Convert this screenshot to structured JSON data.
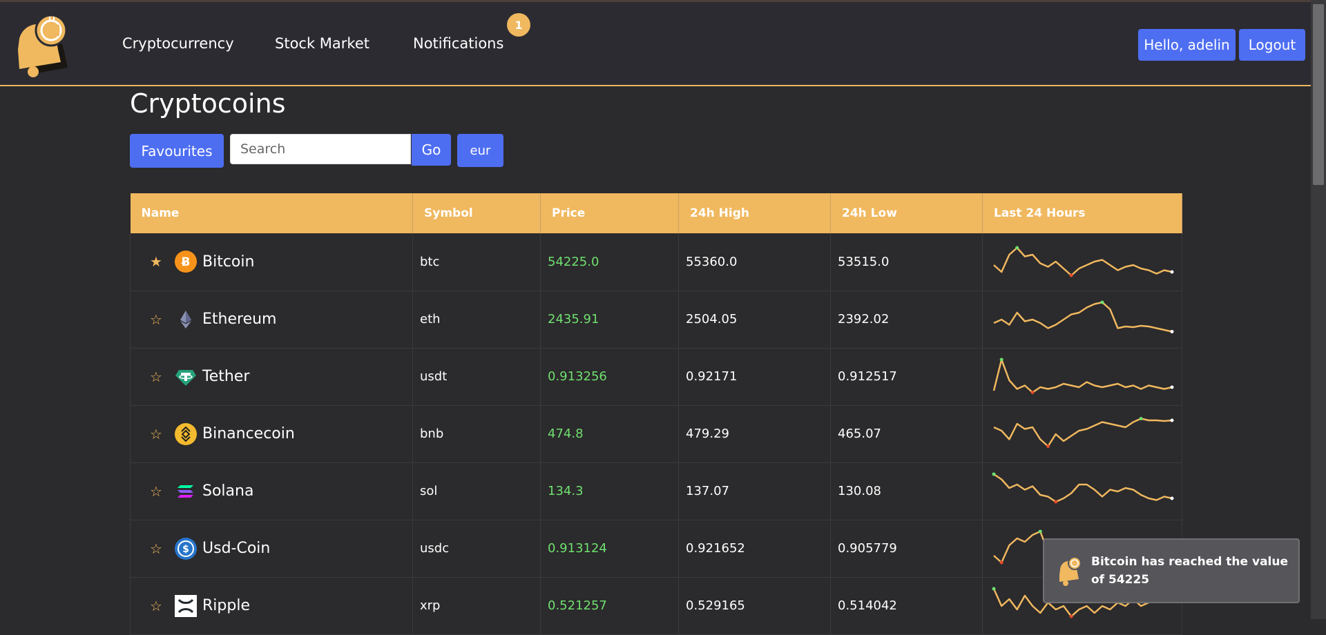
{
  "nav": {
    "links": [
      "Cryptocurrency",
      "Stock Market",
      "Notifications"
    ],
    "notification_count": "1",
    "greeting": "Hello, adelin",
    "logout": "Logout"
  },
  "page": {
    "title": "Cryptocoins",
    "favourites_label": "Favourites",
    "search_placeholder": "Search",
    "go_label": "Go",
    "currency": "eur"
  },
  "table": {
    "headers": [
      "Name",
      "Symbol",
      "Price",
      "24h High",
      "24h Low",
      "Last 24 Hours"
    ],
    "rows": [
      {
        "favourite": true,
        "icon": "bitcoin-icon",
        "name": "Bitcoin",
        "symbol": "btc",
        "price": "54225.0",
        "high": "55360.0",
        "low": "53515.0",
        "spark": [
          0.6,
          0.8,
          0.3,
          0.1,
          0.35,
          0.3,
          0.55,
          0.65,
          0.5,
          0.7,
          0.9,
          0.7,
          0.6,
          0.5,
          0.45,
          0.6,
          0.75,
          0.65,
          0.6,
          0.7,
          0.75,
          0.85,
          0.75,
          0.8
        ]
      },
      {
        "favourite": false,
        "icon": "ethereum-icon",
        "name": "Ethereum",
        "symbol": "eth",
        "price": "2435.91",
        "high": "2504.05",
        "low": "2392.02",
        "spark": [
          0.6,
          0.5,
          0.65,
          0.3,
          0.55,
          0.5,
          0.6,
          0.75,
          0.65,
          0.5,
          0.35,
          0.3,
          0.15,
          0.05,
          0.0,
          0.2,
          0.75,
          0.7,
          0.72,
          0.68,
          0.7,
          0.75,
          0.8,
          0.85
        ]
      },
      {
        "favourite": false,
        "icon": "tether-icon",
        "name": "Tether",
        "symbol": "usdt",
        "price": "0.913256",
        "high": "0.92171",
        "low": "0.912517",
        "spark": [
          0.9,
          0.0,
          0.6,
          0.85,
          0.75,
          0.95,
          0.8,
          0.85,
          0.8,
          0.7,
          0.75,
          0.8,
          0.65,
          0.75,
          0.8,
          0.75,
          0.7,
          0.8,
          0.75,
          0.85,
          0.75,
          0.8,
          0.85,
          0.8
        ]
      },
      {
        "favourite": false,
        "icon": "binance-icon",
        "name": "Binancecoin",
        "symbol": "bnb",
        "price": "474.8",
        "high": "479.29",
        "low": "465.07",
        "spark": [
          0.3,
          0.4,
          0.65,
          0.2,
          0.35,
          0.3,
          0.65,
          0.85,
          0.5,
          0.7,
          0.55,
          0.4,
          0.35,
          0.25,
          0.15,
          0.2,
          0.25,
          0.3,
          0.15,
          0.05,
          0.1,
          0.1,
          0.12,
          0.1
        ]
      },
      {
        "favourite": false,
        "icon": "solana-icon",
        "name": "Solana",
        "symbol": "sol",
        "price": "134.3",
        "high": "137.07",
        "low": "130.08",
        "spark": [
          0.0,
          0.15,
          0.4,
          0.3,
          0.45,
          0.35,
          0.6,
          0.65,
          0.8,
          0.7,
          0.55,
          0.3,
          0.3,
          0.45,
          0.65,
          0.45,
          0.5,
          0.4,
          0.45,
          0.6,
          0.7,
          0.75,
          0.65,
          0.7
        ]
      },
      {
        "favourite": false,
        "icon": "usdc-icon",
        "name": "Usd-Coin",
        "symbol": "usdc",
        "price": "0.913124",
        "high": "0.921652",
        "low": "0.905779",
        "spark": [
          0.7,
          0.9,
          0.4,
          0.2,
          0.3,
          0.1,
          0.0,
          0.6,
          0.5,
          0.45,
          0.7,
          0.6,
          0.5,
          0.55,
          0.6,
          0.5,
          0.55,
          0.5,
          0.6,
          0.55,
          0.5,
          0.6,
          0.55,
          0.6
        ]
      },
      {
        "favourite": false,
        "icon": "ripple-icon",
        "name": "Ripple",
        "symbol": "xrp",
        "price": "0.521257",
        "high": "0.529165",
        "low": "0.514042",
        "spark": [
          0.0,
          0.5,
          0.3,
          0.6,
          0.2,
          0.5,
          0.7,
          0.4,
          0.6,
          0.5,
          0.8,
          0.6,
          0.5,
          0.7,
          0.5,
          0.6,
          0.4,
          0.5,
          0.3,
          0.5,
          0.4,
          0.3,
          0.2,
          0.1
        ]
      }
    ]
  },
  "toast": {
    "message": "Bitcoin has reached the value of 54225"
  },
  "colors": {
    "accent": "#f0b85f",
    "button": "#4e6ef2",
    "price": "#6fe06f",
    "background": "#2b2a2c"
  }
}
